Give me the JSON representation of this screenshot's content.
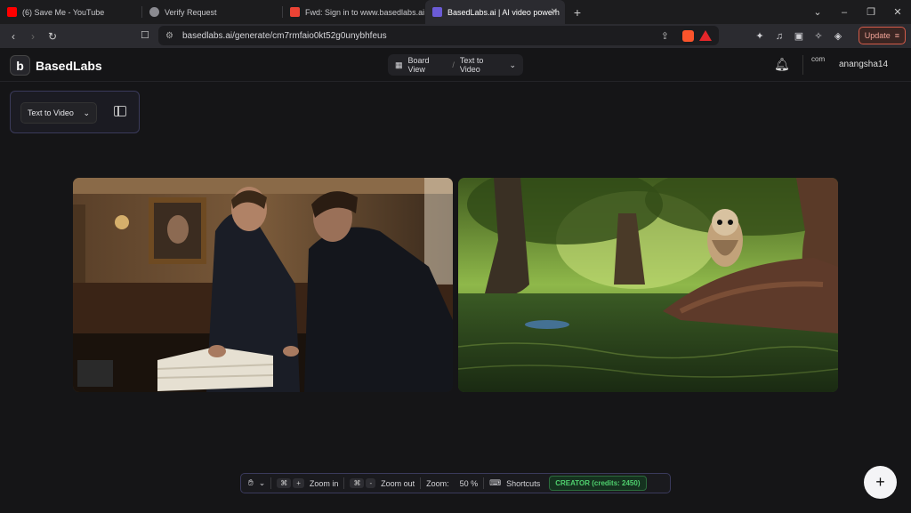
{
  "browser": {
    "tabs": [
      {
        "title": "(6) Save Me - YouTube",
        "favicon_color": "#ff0000"
      },
      {
        "title": "Verify Request",
        "favicon_color": "#9a9aa0"
      },
      {
        "title": "Fwd: Sign in to www.basedlabs.ai - c",
        "favicon_color": "#ea4335"
      },
      {
        "title": "BasedLabs.ai | AI video powerh",
        "favicon_color": "#6b5bd6"
      }
    ],
    "url": "basedlabs.ai/generate/cm7rmfaio0kt52g0unybhfeus",
    "update_label": "Update"
  },
  "app": {
    "brand": "BasedLabs",
    "breadcrumb": {
      "board": "Board View",
      "mode": "Text to Video"
    },
    "username": "anangsha14",
    "avatar_text": "com"
  },
  "mode_panel": {
    "selected": "Text to Video"
  },
  "canvas": {
    "cards": [
      {
        "description_icon": "office-scene-image"
      },
      {
        "description_icon": "owl-forest-scene-image"
      }
    ]
  },
  "toolbar": {
    "zoom_in_label": "Zoom in",
    "zoom_out_label": "Zoom out",
    "zoom_label": "Zoom:",
    "zoom_value": "50 %",
    "shortcuts_label": "Shortcuts",
    "credits": "CREATOR (credits: 2450)",
    "kbd_cmd": "⌘",
    "kbd_plus": "+",
    "kbd_minus": "-"
  },
  "colors": {
    "accent_border": "#3a3a5c",
    "credits_green": "#4fd06e",
    "update_red": "#d45b49"
  }
}
